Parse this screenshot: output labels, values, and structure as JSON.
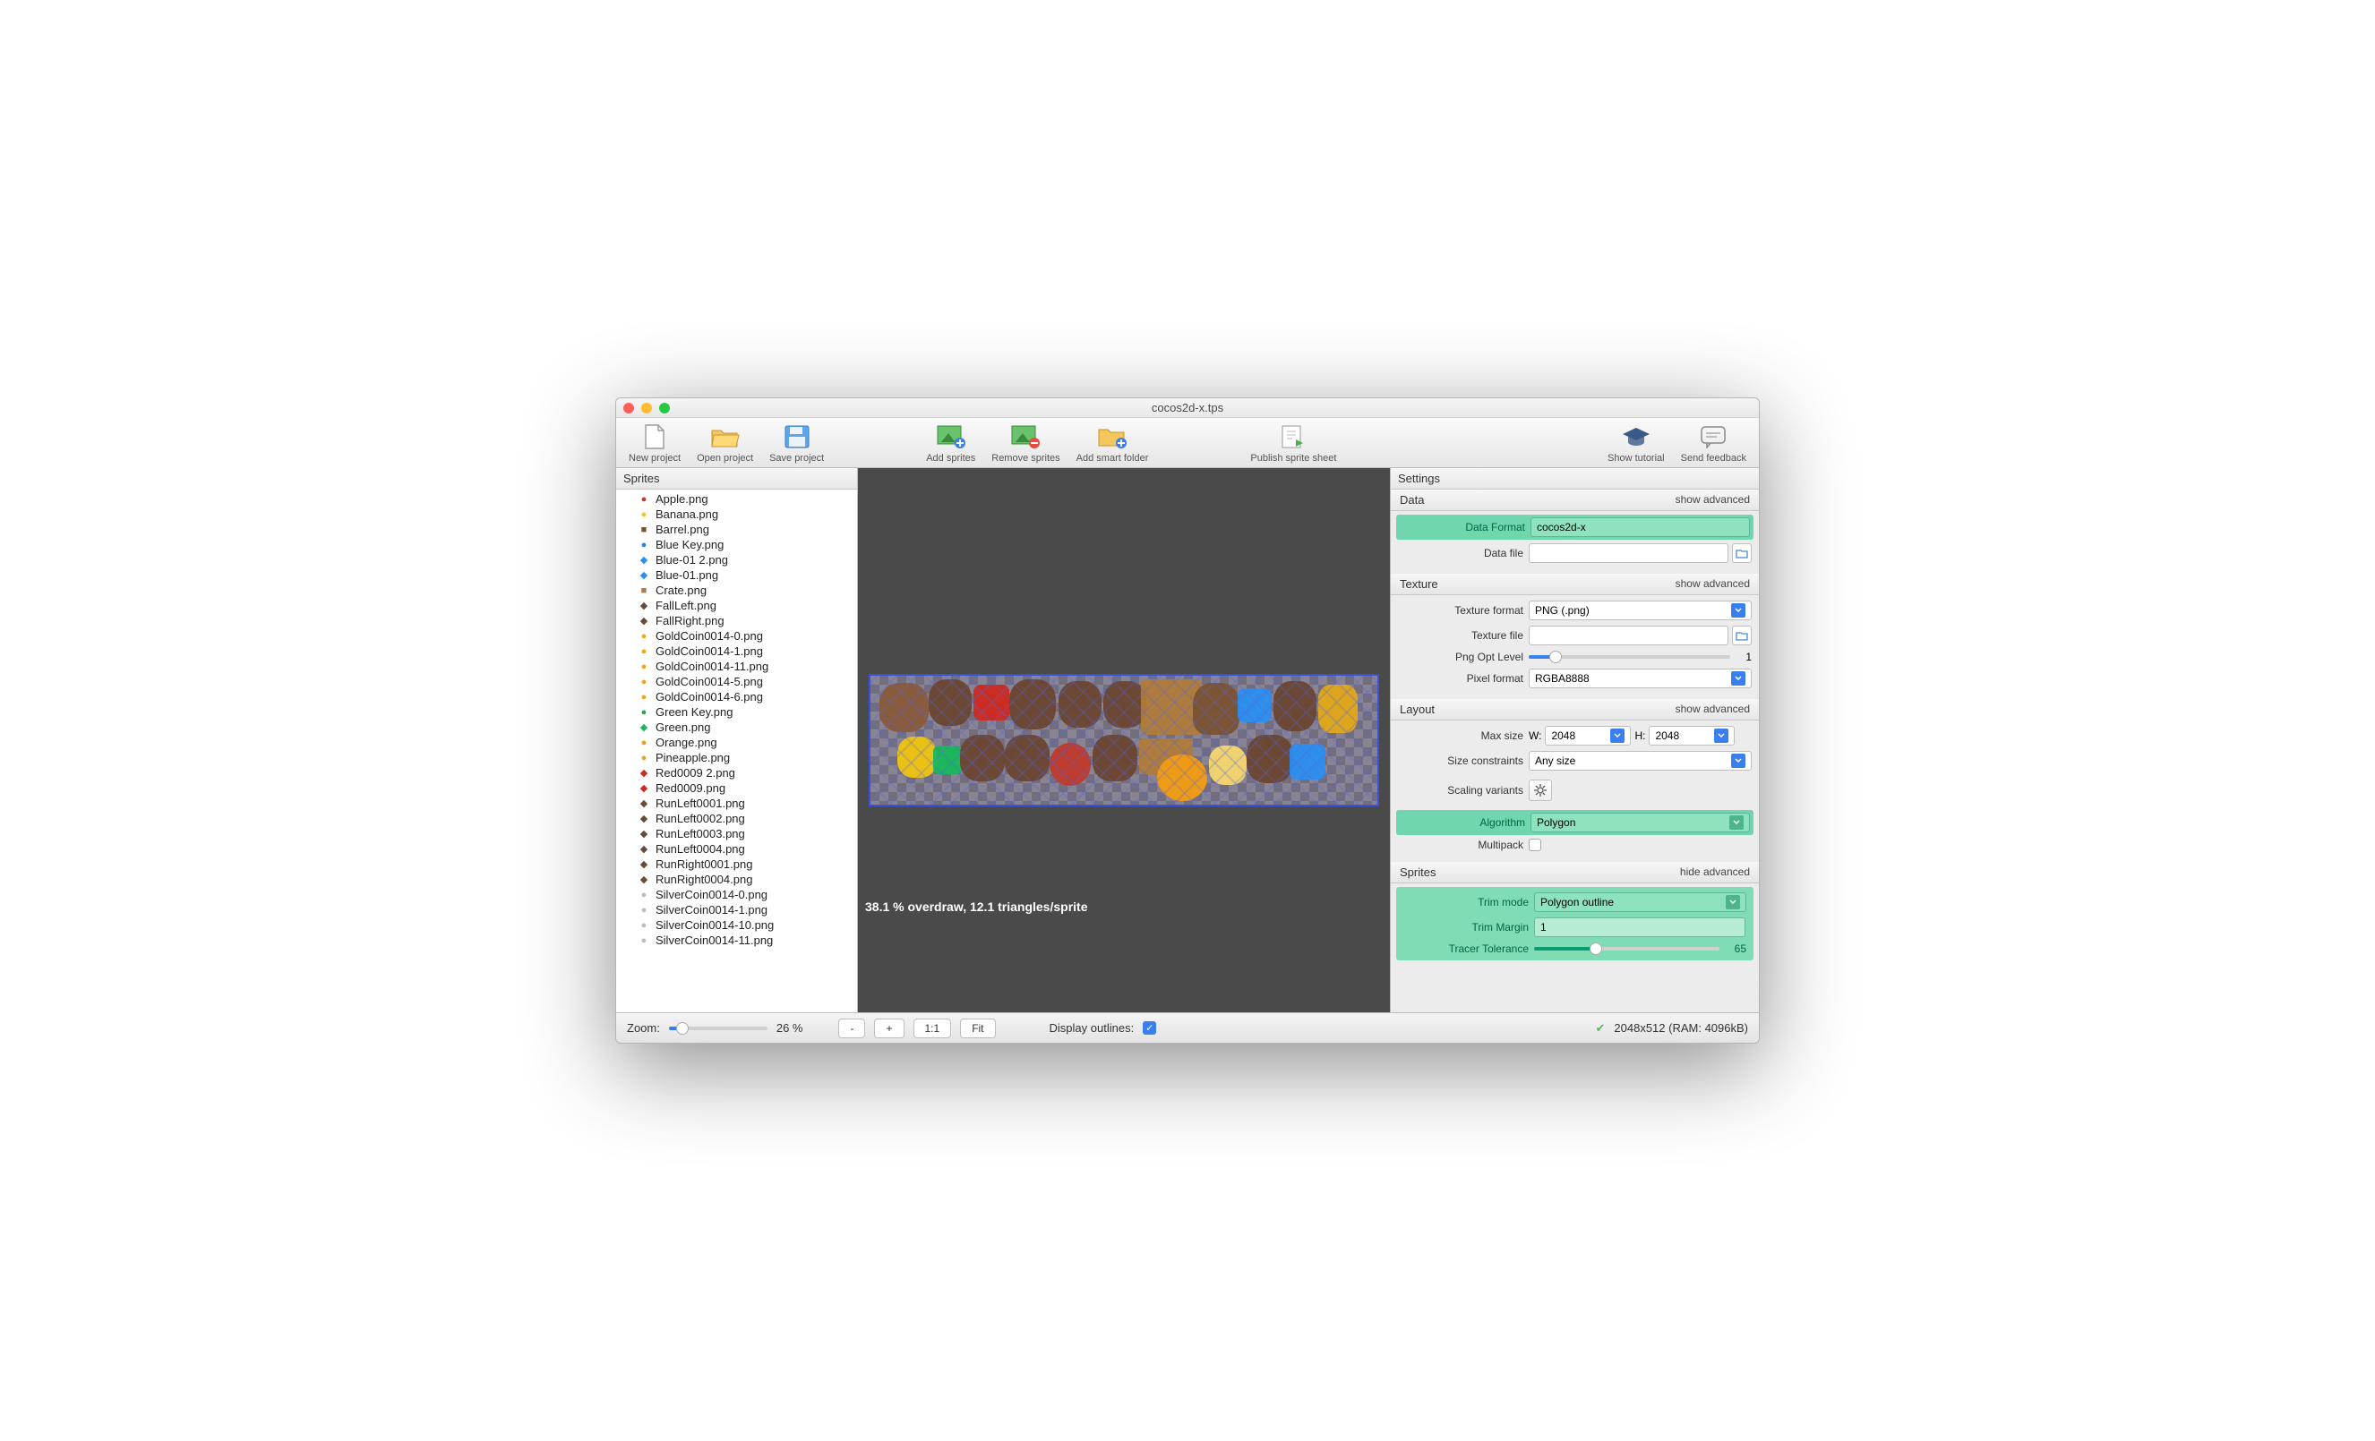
{
  "window": {
    "title": "cocos2d-x.tps"
  },
  "toolbar": {
    "new_project": "New project",
    "open_project": "Open project",
    "save_project": "Save project",
    "add_sprites": "Add sprites",
    "remove_sprites": "Remove sprites",
    "add_smart_folder": "Add smart folder",
    "publish": "Publish sprite sheet",
    "show_tutorial": "Show tutorial",
    "send_feedback": "Send feedback"
  },
  "sidebar": {
    "title": "Sprites",
    "items": [
      {
        "label": "Apple.png",
        "color": "#c0392b",
        "glyph": "●"
      },
      {
        "label": "Banana.png",
        "color": "#f1c40f",
        "glyph": "●"
      },
      {
        "label": "Barrel.png",
        "color": "#7a5230",
        "glyph": "■"
      },
      {
        "label": "Blue Key.png",
        "color": "#2980d9",
        "glyph": "●"
      },
      {
        "label": "Blue-01 2.png",
        "color": "#2b8ef0",
        "glyph": "◆"
      },
      {
        "label": "Blue-01.png",
        "color": "#2b8ef0",
        "glyph": "◆"
      },
      {
        "label": "Crate.png",
        "color": "#b07b3b",
        "glyph": "■"
      },
      {
        "label": "FallLeft.png",
        "color": "#6b4a3a",
        "glyph": "◆"
      },
      {
        "label": "FallRight.png",
        "color": "#6b4a3a",
        "glyph": "◆"
      },
      {
        "label": "GoldCoin0014-0.png",
        "color": "#f1a90f",
        "glyph": "●"
      },
      {
        "label": "GoldCoin0014-1.png",
        "color": "#f1a90f",
        "glyph": "●"
      },
      {
        "label": "GoldCoin0014-11.png",
        "color": "#f1a90f",
        "glyph": "●"
      },
      {
        "label": "GoldCoin0014-5.png",
        "color": "#f1a90f",
        "glyph": "●"
      },
      {
        "label": "GoldCoin0014-6.png",
        "color": "#f1a90f",
        "glyph": "●"
      },
      {
        "label": "Green Key.png",
        "color": "#1fa84a",
        "glyph": "●"
      },
      {
        "label": "Green.png",
        "color": "#17b85b",
        "glyph": "◆"
      },
      {
        "label": "Orange.png",
        "color": "#f39c12",
        "glyph": "●"
      },
      {
        "label": "Pineapple.png",
        "color": "#e1a818",
        "glyph": "●"
      },
      {
        "label": "Red0009 2.png",
        "color": "#d0281e",
        "glyph": "◆"
      },
      {
        "label": "Red0009.png",
        "color": "#d0281e",
        "glyph": "◆"
      },
      {
        "label": "RunLeft0001.png",
        "color": "#6b4a3a",
        "glyph": "◆"
      },
      {
        "label": "RunLeft0002.png",
        "color": "#6b4a3a",
        "glyph": "◆"
      },
      {
        "label": "RunLeft0003.png",
        "color": "#6b4a3a",
        "glyph": "◆"
      },
      {
        "label": "RunLeft0004.png",
        "color": "#6b4a3a",
        "glyph": "◆"
      },
      {
        "label": "RunRight0001.png",
        "color": "#6b4a3a",
        "glyph": "◆"
      },
      {
        "label": "RunRight0004.png",
        "color": "#6b4a3a",
        "glyph": "◆"
      },
      {
        "label": "SilverCoin0014-0.png",
        "color": "#bdbdbd",
        "glyph": "●"
      },
      {
        "label": "SilverCoin0014-1.png",
        "color": "#bdbdbd",
        "glyph": "●"
      },
      {
        "label": "SilverCoin0014-10.png",
        "color": "#bdbdbd",
        "glyph": "●"
      },
      {
        "label": "SilverCoin0014-11.png",
        "color": "#bdbdbd",
        "glyph": "●"
      }
    ]
  },
  "canvas": {
    "overdraw_text": "38.1 % overdraw, 12.1 triangles/sprite"
  },
  "settings": {
    "title": "Settings",
    "data": {
      "head": "Data",
      "adv": "show advanced",
      "format_label": "Data Format",
      "format_value": "cocos2d-x",
      "file_label": "Data file"
    },
    "texture": {
      "head": "Texture",
      "adv": "show advanced",
      "format_label": "Texture format",
      "format_value": "PNG (.png)",
      "file_label": "Texture file",
      "opt_label": "Png Opt Level",
      "opt_value": "1",
      "pixel_label": "Pixel format",
      "pixel_value": "RGBA8888"
    },
    "layout": {
      "head": "Layout",
      "adv": "show advanced",
      "max_label": "Max size",
      "w_label": "W:",
      "w_value": "2048",
      "h_label": "H:",
      "h_value": "2048",
      "constraints_label": "Size constraints",
      "constraints_value": "Any size",
      "variants_label": "Scaling variants",
      "algo_label": "Algorithm",
      "algo_value": "Polygon",
      "multipack_label": "Multipack"
    },
    "sprites": {
      "head": "Sprites",
      "adv": "hide advanced",
      "trim_label": "Trim mode",
      "trim_value": "Polygon outline",
      "margin_label": "Trim Margin",
      "margin_value": "1",
      "tracer_label": "Tracer Tolerance",
      "tracer_value": "65"
    }
  },
  "status": {
    "zoom_label": "Zoom:",
    "zoom_value": "26 %",
    "minus": "-",
    "plus": "+",
    "oneone": "1:1",
    "fit": "Fit",
    "outlines_label": "Display outlines:",
    "size_text": "2048x512 (RAM: 4096kB)"
  }
}
